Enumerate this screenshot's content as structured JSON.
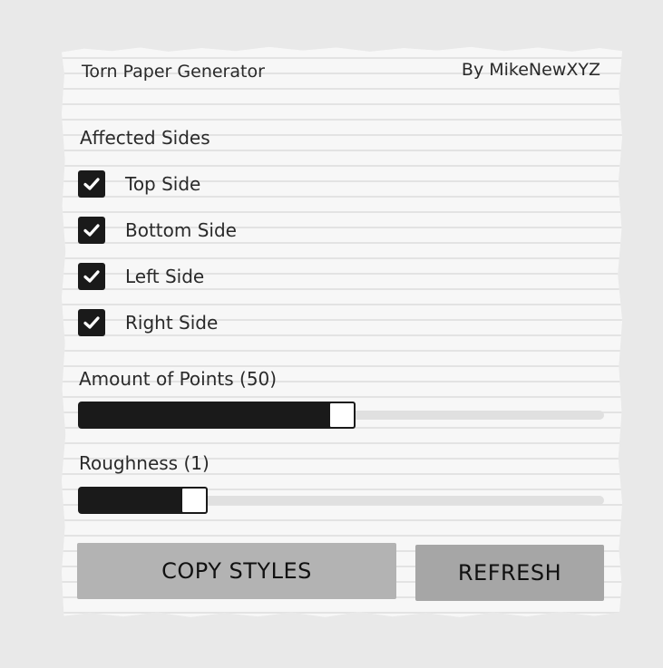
{
  "header": {
    "title": "Torn Paper Generator",
    "author": "By MikeNewXYZ"
  },
  "sides": {
    "label": "Affected Sides",
    "items": [
      {
        "label": "Top Side",
        "checked": true
      },
      {
        "label": "Bottom Side",
        "checked": true
      },
      {
        "label": "Left Side",
        "checked": true
      },
      {
        "label": "Right Side",
        "checked": true
      }
    ]
  },
  "points": {
    "label": "Amount of Points (50)",
    "fraction": 0.52
  },
  "roughness": {
    "label": "Roughness (1)",
    "fraction": 0.24
  },
  "buttons": {
    "copy": "COPY STYLES",
    "refresh": "REFRESH"
  },
  "colors": {
    "background": "#e9e9e9",
    "paper": "#f7f7f7",
    "accent": "#1a1a1a",
    "copy_button": "#b3b3b3",
    "refresh_button": "#a6a6a6"
  },
  "icons": {
    "checkmark": "check-icon"
  }
}
